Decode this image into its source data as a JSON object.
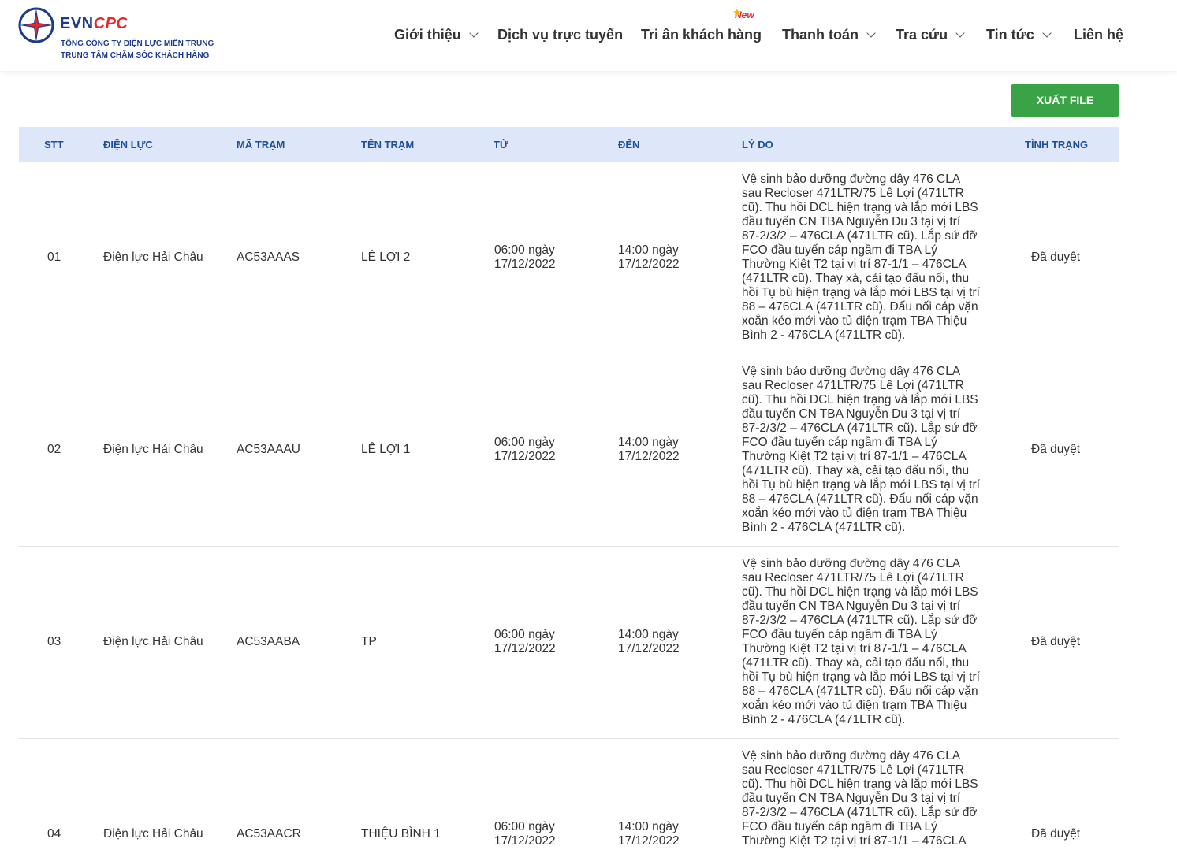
{
  "header": {
    "logo": {
      "brand_evn": "EVN",
      "brand_cpc": "CPC",
      "line1": "TỔNG CÔNG TY ĐIỆN LỰC MIỀN TRUNG",
      "line2": "TRUNG TÂM CHĂM SÓC KHÁCH HÀNG"
    },
    "nav": [
      {
        "label": "Giới thiệu",
        "has_dropdown": true
      },
      {
        "label": "Dịch vụ trực tuyến",
        "has_dropdown": false
      },
      {
        "label": "Tri ân khách hàng",
        "has_dropdown": false,
        "badge": "New"
      },
      {
        "label": "Thanh toán",
        "has_dropdown": true
      },
      {
        "label": "Tra cứu",
        "has_dropdown": true
      },
      {
        "label": "Tin tức",
        "has_dropdown": true
      },
      {
        "label": "Liên hệ",
        "has_dropdown": false
      }
    ]
  },
  "toolbar": {
    "export_label": "XUẤT FILE"
  },
  "colors": {
    "brand_blue": "#1e3c8c",
    "brand_red": "#e4282c",
    "header_bg": "#dee6f9",
    "header_text": "#1d4f9c",
    "export_green": "#3aa346"
  },
  "table": {
    "columns": [
      "STT",
      "ĐIỆN LỰC",
      "MÃ TRẠM",
      "TÊN TRẠM",
      "TỪ",
      "ĐẾN",
      "LÝ DO",
      "TÌNH TRẠNG"
    ],
    "rows": [
      {
        "stt": "01",
        "dien_luc": "Điện lực Hải Châu",
        "ma_tram": "AC53AAAS",
        "ten_tram": "LÊ LỢI 2",
        "tu": "06:00 ngày 17/12/2022",
        "den": "14:00 ngày 17/12/2022",
        "ly_do": "Vệ sinh bảo dưỡng đường dây 476 CLA sau Recloser 471LTR/75 Lê Lợi (471LTR cũ). Thu hồi DCL hiện trạng và lắp mới LBS đầu tuyến CN TBA Nguyễn Du 3 tại vị trí 87-2/3/2 – 476CLA (471LTR cũ). Lắp sứ đỡ FCO đầu tuyến cáp ngầm đi TBA Lý Thường Kiệt T2 tại vị trí 87-1/1 – 476CLA (471LTR cũ). Thay xà, cải tạo đấu nối, thu hồi Tụ bù hiện trạng và lắp mới LBS tại vị trí 88 – 476CLA (471LTR cũ). Đấu nối cáp vặn xoắn kéo mới vào tủ điện trạm TBA Thiệu Bình 2 - 476CLA (471LTR cũ).",
        "tinh_trang": "Đã duyệt"
      },
      {
        "stt": "02",
        "dien_luc": "Điện lực Hải Châu",
        "ma_tram": "AC53AAAU",
        "ten_tram": "LÊ LỢI 1",
        "tu": "06:00 ngày 17/12/2022",
        "den": "14:00 ngày 17/12/2022",
        "ly_do": "Vệ sinh bảo dưỡng đường dây 476 CLA sau Recloser 471LTR/75 Lê Lợi (471LTR cũ). Thu hồi DCL hiện trạng và lắp mới LBS đầu tuyến CN TBA Nguyễn Du 3 tại vị trí 87-2/3/2 – 476CLA (471LTR cũ). Lắp sứ đỡ FCO đầu tuyến cáp ngầm đi TBA Lý Thường Kiệt T2 tại vị trí 87-1/1 – 476CLA (471LTR cũ). Thay xà, cải tạo đấu nối, thu hồi Tụ bù hiện trạng và lắp mới LBS tại vị trí 88 – 476CLA (471LTR cũ). Đấu nối cáp vặn xoắn kéo mới vào tủ điện trạm TBA Thiệu Bình 2 - 476CLA (471LTR cũ).",
        "tinh_trang": "Đã duyệt"
      },
      {
        "stt": "03",
        "dien_luc": "Điện lực Hải Châu",
        "ma_tram": "AC53AABA",
        "ten_tram": "TP",
        "tu": "06:00 ngày 17/12/2022",
        "den": "14:00 ngày 17/12/2022",
        "ly_do": "Vệ sinh bảo dưỡng đường dây 476 CLA sau Recloser 471LTR/75 Lê Lợi (471LTR cũ). Thu hồi DCL hiện trạng và lắp mới LBS đầu tuyến CN TBA Nguyễn Du 3 tại vị trí 87-2/3/2 – 476CLA (471LTR cũ). Lắp sứ đỡ FCO đầu tuyến cáp ngầm đi TBA Lý Thường Kiệt T2 tại vị trí 87-1/1 – 476CLA (471LTR cũ). Thay xà, cải tạo đấu nối, thu hồi Tụ bù hiện trạng và lắp mới LBS tại vị trí 88 – 476CLA (471LTR cũ). Đấu nối cáp vặn xoắn kéo mới vào tủ điện trạm TBA Thiệu Bình 2 - 476CLA (471LTR cũ).",
        "tinh_trang": "Đã duyệt"
      },
      {
        "stt": "04",
        "dien_luc": "Điện lực Hải Châu",
        "ma_tram": "AC53AACR",
        "ten_tram": "THIỆU BÌNH 1",
        "tu": "06:00 ngày 17/12/2022",
        "den": "14:00 ngày 17/12/2022",
        "ly_do": "Vệ sinh bảo dưỡng đường dây 476 CLA sau Recloser 471LTR/75 Lê Lợi (471LTR cũ). Thu hồi DCL hiện trạng và lắp mới LBS đầu tuyến CN TBA Nguyễn Du 3 tại vị trí 87-2/3/2 – 476CLA (471LTR cũ). Lắp sứ đỡ FCO đầu tuyến cáp ngầm đi TBA Lý Thường Kiệt T2 tại vị trí 87-1/1 – 476CLA",
        "tinh_trang": "Đã duyệt"
      }
    ]
  }
}
